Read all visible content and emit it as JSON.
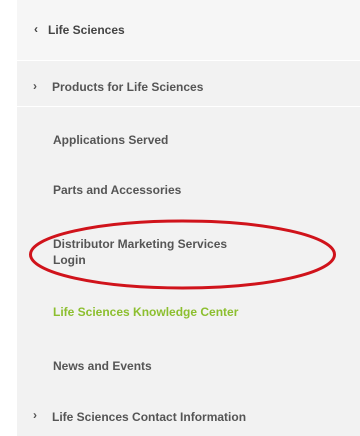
{
  "nav": {
    "back": {
      "icon": "chevron-left-icon",
      "label": "Life Sciences"
    },
    "products": {
      "icon": "chevron-right-icon",
      "label": "Products for Life Sciences"
    },
    "items": [
      {
        "label": "Applications Served"
      },
      {
        "label": "Parts and Accessories"
      },
      {
        "label_line1": "Distributor Marketing Services",
        "label_line2": "Login"
      },
      {
        "label": "Life Sciences Knowledge Center"
      },
      {
        "label": "News and Events"
      }
    ],
    "contact": {
      "icon": "chevron-right-icon",
      "label": "Life Sciences Contact Information"
    }
  },
  "colors": {
    "panel_bg": "#f2f2f2",
    "text": "#555555",
    "highlight_text": "#8cbf2f",
    "annotation_oval": "#d0131b"
  },
  "symbols": {
    "left": "‹",
    "right": "›"
  }
}
